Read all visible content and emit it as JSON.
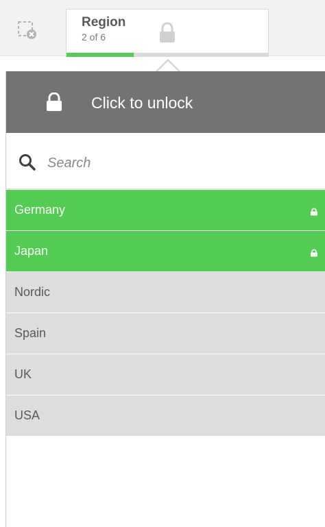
{
  "toolbar": {
    "clear_selections_icon": "clear-selections-icon"
  },
  "field": {
    "name": "Region",
    "count_text": "2 of 6",
    "selected_fraction": 0.333,
    "lock_icon": "lock-icon"
  },
  "popover": {
    "unlock_label": "Click to unlock",
    "search_placeholder": "Search",
    "search_value": "",
    "items": [
      {
        "label": "Germany",
        "state": "selected",
        "locked": true
      },
      {
        "label": "Japan",
        "state": "selected",
        "locked": true
      },
      {
        "label": "Nordic",
        "state": "possible",
        "locked": false
      },
      {
        "label": "Spain",
        "state": "possible",
        "locked": false
      },
      {
        "label": "UK",
        "state": "possible",
        "locked": false
      },
      {
        "label": "USA",
        "state": "possible",
        "locked": false
      }
    ]
  },
  "colors": {
    "selected": "#52cc52",
    "possible": "#dddddd",
    "locked_bar": "#737373"
  }
}
